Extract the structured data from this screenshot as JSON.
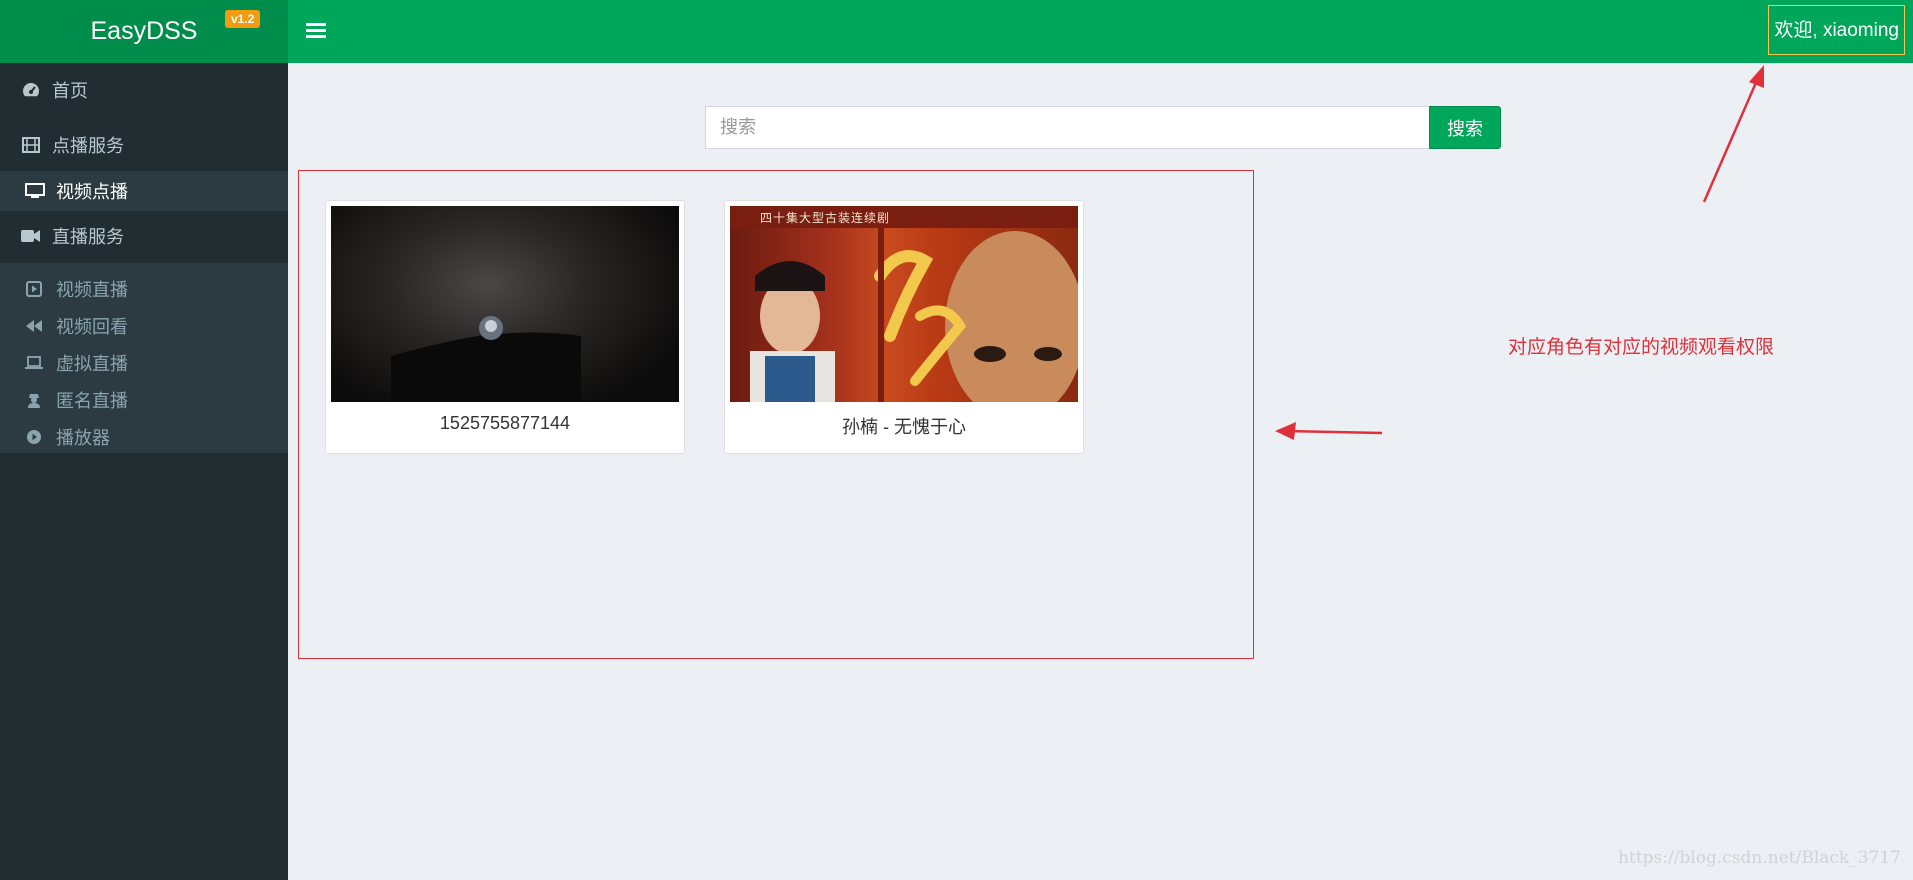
{
  "header": {
    "app_title": "EasyDSS",
    "version": "v1.2",
    "welcome": "欢迎, xiaoming"
  },
  "sidebar": {
    "items": [
      {
        "label": "首页",
        "icon": "dashboard-icon"
      },
      {
        "label": "点播服务",
        "icon": "film-icon"
      },
      {
        "label": "视频点播",
        "icon": "monitor-icon",
        "active": true
      },
      {
        "label": "直播服务",
        "icon": "video-camera-icon"
      }
    ],
    "live_sub_items": [
      {
        "label": "视频直播",
        "icon": "play-square-icon"
      },
      {
        "label": "视频回看",
        "icon": "backward-icon"
      },
      {
        "label": "虚拟直播",
        "icon": "laptop-icon"
      },
      {
        "label": "匿名直播",
        "icon": "user-secret-icon"
      },
      {
        "label": "播放器",
        "icon": "play-circle-icon"
      }
    ]
  },
  "search": {
    "placeholder": "搜索",
    "value": "",
    "button_label": "搜索"
  },
  "videos": [
    {
      "title": "1525755877144"
    },
    {
      "title": "孙楠 - 无愧于心",
      "poster_text": "四十集大型古装连续剧"
    }
  ],
  "annotation": {
    "text": "对应角色有对应的视频观看权限",
    "color": "#e0303a"
  },
  "watermark": "https://blog.csdn.net/Black_3717",
  "colors": {
    "brand_green": "#00a65a",
    "brand_green_dark": "#008d4c",
    "sidebar_bg": "#222d32",
    "badge": "#f39c12"
  }
}
